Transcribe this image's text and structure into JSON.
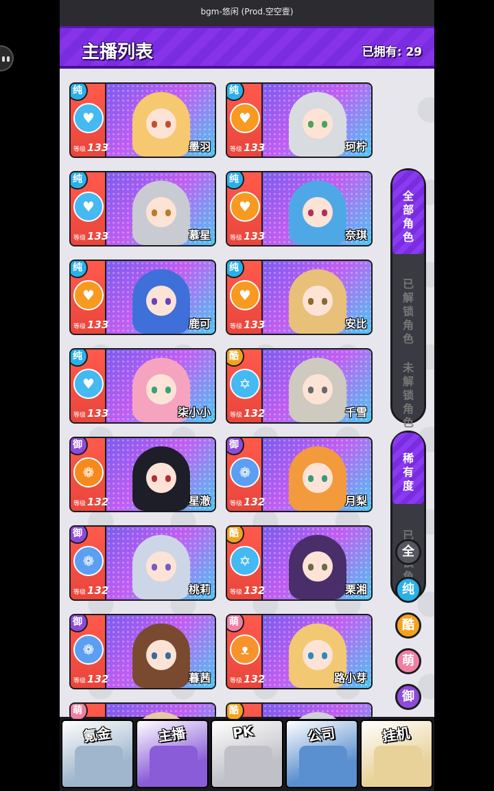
{
  "status_bar": {
    "bgm": "bgm-悠闲 (Prod.空空壹)"
  },
  "header": {
    "title": "主播列表",
    "owned": "已拥有: 29"
  },
  "colors": {
    "accent": "#7a2ce0",
    "pure": "#2ab0e8",
    "cool": "#f2a31d",
    "cute": "#f07fa2",
    "royal": "#8d4bd8",
    "card_red": "#e9453b"
  },
  "level_label": "等级",
  "cards": [
    {
      "attr": "纯",
      "attr_class": "pure",
      "skill_icon": "heart-pulse-icon",
      "skill_class": "pure",
      "level": "133",
      "name": "墨羽",
      "hair": "#f6c870",
      "eyes": "#c05030"
    },
    {
      "attr": "纯",
      "attr_class": "pure",
      "skill_icon": "heart-pulse-icon",
      "skill_class": "cool",
      "level": "133",
      "name": "珂柠",
      "hair": "#d8dbe0",
      "eyes": "#4aa55a"
    },
    {
      "attr": "纯",
      "attr_class": "pure",
      "skill_icon": "heart-pulse-icon",
      "skill_class": "pure",
      "level": "133",
      "name": "慕星",
      "hair": "#c9cbd2",
      "eyes": "#c0792a"
    },
    {
      "attr": "纯",
      "attr_class": "pure",
      "skill_icon": "heart-pulse-icon",
      "skill_class": "cool",
      "level": "133",
      "name": "奈琪",
      "hair": "#4fa8e6",
      "eyes": "#b0305a"
    },
    {
      "attr": "纯",
      "attr_class": "pure",
      "skill_icon": "heart-pulse-icon",
      "skill_class": "cool",
      "level": "133",
      "name": "鹿可",
      "hair": "#3f6fd8",
      "eyes": "#6a3fbf"
    },
    {
      "attr": "纯",
      "attr_class": "pure",
      "skill_icon": "heart-pulse-icon",
      "skill_class": "cool",
      "level": "133",
      "name": "安比",
      "hair": "#e8c07a",
      "eyes": "#8a6a2a"
    },
    {
      "attr": "纯",
      "attr_class": "pure",
      "skill_icon": "heart-pulse-icon",
      "skill_class": "pure",
      "level": "133",
      "name": "柒小小",
      "hair": "#f6a3c0",
      "eyes": "#3aa07a"
    },
    {
      "attr": "酷",
      "attr_class": "cool",
      "skill_icon": "star-of-david-icon",
      "skill_class": "pure",
      "level": "132",
      "name": "千雪",
      "hair": "#cfcac0",
      "eyes": "#6a6a6a"
    },
    {
      "attr": "御",
      "attr_class": "royal",
      "skill_icon": "rose-icon",
      "skill_class": "royal",
      "level": "132",
      "name": "星澈",
      "hair": "#1e1e28",
      "eyes": "#b0303a"
    },
    {
      "attr": "御",
      "attr_class": "royal",
      "skill_icon": "rose-icon",
      "skill_class": "royal-b",
      "level": "132",
      "name": "月梨",
      "hair": "#f29a3c",
      "eyes": "#3a9a7a"
    },
    {
      "attr": "御",
      "attr_class": "royal",
      "skill_icon": "rose-icon",
      "skill_class": "royal-b",
      "level": "132",
      "name": "桃莉",
      "hair": "#cdd6e6",
      "eyes": "#7a5ac0"
    },
    {
      "attr": "酷",
      "attr_class": "cool",
      "skill_icon": "star-of-david-icon",
      "skill_class": "pure",
      "level": "132",
      "name": "栗湘",
      "hair": "#4a2e6a",
      "eyes": "#6a6a4a"
    },
    {
      "attr": "御",
      "attr_class": "royal",
      "skill_icon": "rose-icon",
      "skill_class": "royal-b",
      "level": "132",
      "name": "暮茜",
      "hair": "#7a4a30",
      "eyes": "#3a6a9a"
    },
    {
      "attr": "萌",
      "attr_class": "cute",
      "skill_icon": "cat-face-icon",
      "skill_class": "cute",
      "level": "132",
      "name": "路小芽",
      "hair": "#f3c873",
      "eyes": "#2a8ac0"
    },
    {
      "attr": "萌",
      "attr_class": "cute",
      "skill_icon": "",
      "skill_class": "cute",
      "level": "",
      "name": "",
      "hair": "#e8c8a0",
      "eyes": "#fde3d6"
    },
    {
      "attr": "酷",
      "attr_class": "cool",
      "skill_icon": "",
      "skill_class": "cool",
      "level": "",
      "name": "",
      "hair": "#cfcfd6",
      "eyes": "#fde3d6"
    }
  ],
  "filter_tabs": [
    {
      "label": "全部角色",
      "active": true
    },
    {
      "label": "已解锁角色",
      "active": false
    },
    {
      "label": "未解锁角色",
      "active": false
    }
  ],
  "sort_tabs": [
    {
      "label": "稀有度",
      "active": true
    },
    {
      "label": "已解锁角色",
      "active": false
    }
  ],
  "attr_filters": [
    {
      "label": "全",
      "class": "all"
    },
    {
      "label": "纯",
      "class": "pure"
    },
    {
      "label": "酷",
      "class": "cool"
    },
    {
      "label": "萌",
      "class": "cute"
    },
    {
      "label": "御",
      "class": "royal"
    }
  ],
  "bottom_nav": [
    {
      "label": "氪金",
      "icon": "coin-stack-icon",
      "bg": "#9fb6cc"
    },
    {
      "label": "主播",
      "icon": "streamer-pig-icon",
      "bg": "#8a5cd8"
    },
    {
      "label": "PK",
      "icon": "pk-versus-icon",
      "bg": "#c0c0c8"
    },
    {
      "label": "公司",
      "icon": "building-icon",
      "bg": "#5a8fd0"
    },
    {
      "label": "挂机",
      "icon": "piggy-bank-icon",
      "bg": "#e8d29a"
    }
  ]
}
